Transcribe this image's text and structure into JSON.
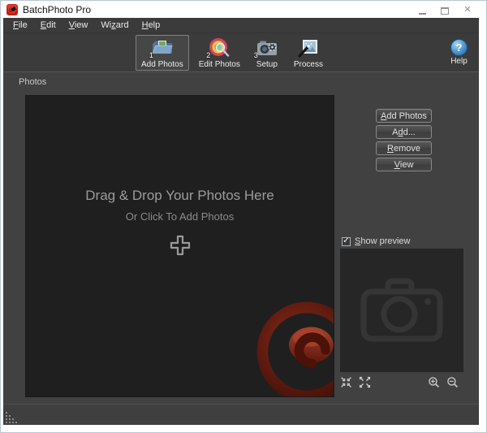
{
  "window": {
    "title": "BatchPhoto Pro"
  },
  "icons": {
    "close": "✕",
    "help": "?",
    "check": "✓"
  },
  "menu": {
    "items": [
      {
        "pre": "",
        "key": "F",
        "post": "ile"
      },
      {
        "pre": "",
        "key": "E",
        "post": "dit"
      },
      {
        "pre": "",
        "key": "V",
        "post": "iew"
      },
      {
        "pre": "Wi",
        "key": "z",
        "post": "ard"
      },
      {
        "pre": "",
        "key": "H",
        "post": "elp"
      }
    ]
  },
  "toolbar": {
    "items": [
      {
        "label": "Add Photos",
        "badge": "1",
        "selected": true
      },
      {
        "label": "Edit Photos",
        "badge": "2",
        "selected": false
      },
      {
        "label": "Setup",
        "badge": "3",
        "selected": false
      },
      {
        "label": "Process",
        "badge": "",
        "selected": false
      }
    ],
    "help_label": "Help"
  },
  "photos_panel": {
    "label": "Photos",
    "dropzone": {
      "title": "Drag & Drop Your Photos Here",
      "subtitle": "Or Click To Add Photos"
    }
  },
  "actions": {
    "buttons": [
      {
        "pre": "",
        "key": "A",
        "post": "dd Photos"
      },
      {
        "pre": "A",
        "key": "d",
        "post": "d..."
      },
      {
        "pre": "",
        "key": "R",
        "post": "emove"
      },
      {
        "pre": "",
        "key": "V",
        "post": "iew"
      }
    ]
  },
  "preview": {
    "checkbox": {
      "pre": "",
      "key": "S",
      "post": "how preview",
      "checked": true
    }
  },
  "colors": {
    "titlebar_bg": "#ffffff",
    "chrome_border": "#b9c7d2",
    "bar_bg": "#3b3b3b",
    "content_bg": "#414141",
    "dropzone_bg": "#1f1f1f",
    "panel_text": "#c9c9c9",
    "button_border": "#8a8a8a",
    "help_blue": "#3f86c6",
    "logo_red": "#6e1d12"
  }
}
